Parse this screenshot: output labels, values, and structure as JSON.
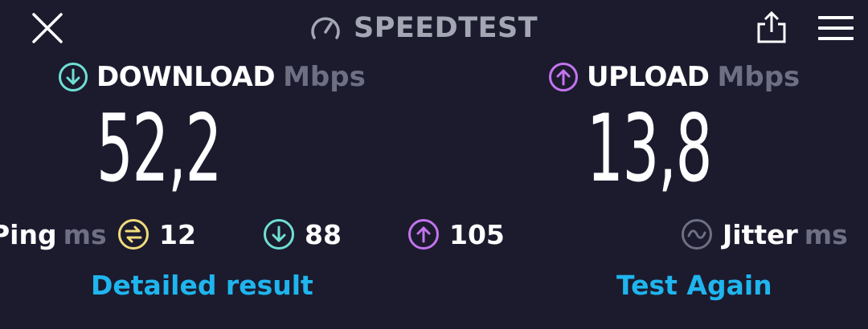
{
  "header": {
    "brand": "SPEEDTEST"
  },
  "download": {
    "label": "DOWNLOAD",
    "unit": "Mbps",
    "value": "52,2",
    "color": "#6fe0d3"
  },
  "upload": {
    "label": "UPLOAD",
    "unit": "Mbps",
    "value": "13,8",
    "color": "#c474ef"
  },
  "ping": {
    "label": "Ping",
    "unit": "ms",
    "idle": "12",
    "download": "88",
    "upload": "105",
    "idle_color": "#f2dc7a"
  },
  "jitter": {
    "label": "Jitter",
    "unit": "ms"
  },
  "actions": {
    "detailed": "Detailed result",
    "again": "Test Again",
    "color": "#1fb5ee"
  }
}
